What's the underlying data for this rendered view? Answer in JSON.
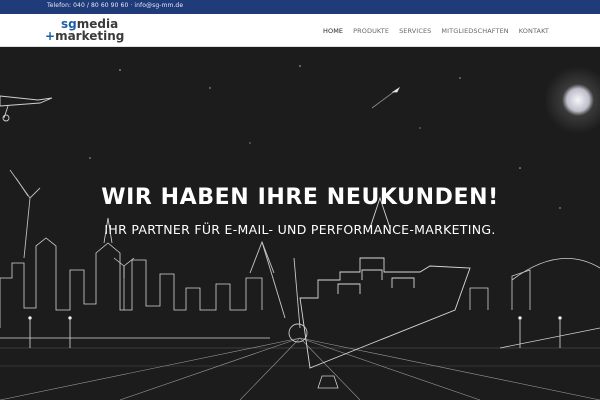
{
  "topbar": {
    "contact": "Telefon: 040 / 80 60 90 60 · info@sg-mm.de"
  },
  "logo": {
    "sg": "sg",
    "media": "media",
    "plus": "+",
    "marketing": "marketing"
  },
  "nav": {
    "items": [
      {
        "label": "HOME",
        "active": true
      },
      {
        "label": "PRODUKTE",
        "active": false
      },
      {
        "label": "SERVICES",
        "active": false
      },
      {
        "label": "MITGLIEDSCHAFTEN",
        "active": false
      },
      {
        "label": "KONTAKT",
        "active": false
      }
    ]
  },
  "hero": {
    "headline": "WIR HABEN IHRE NEUKUNDEN!",
    "subline": "IHR PARTNER FÜR E-MAIL- UND PERFORMANCE-MARKETING."
  },
  "colors": {
    "topbar": "#1f3b7a",
    "accent": "#1f5fa8",
    "hero_bg": "#1a1a1a"
  }
}
